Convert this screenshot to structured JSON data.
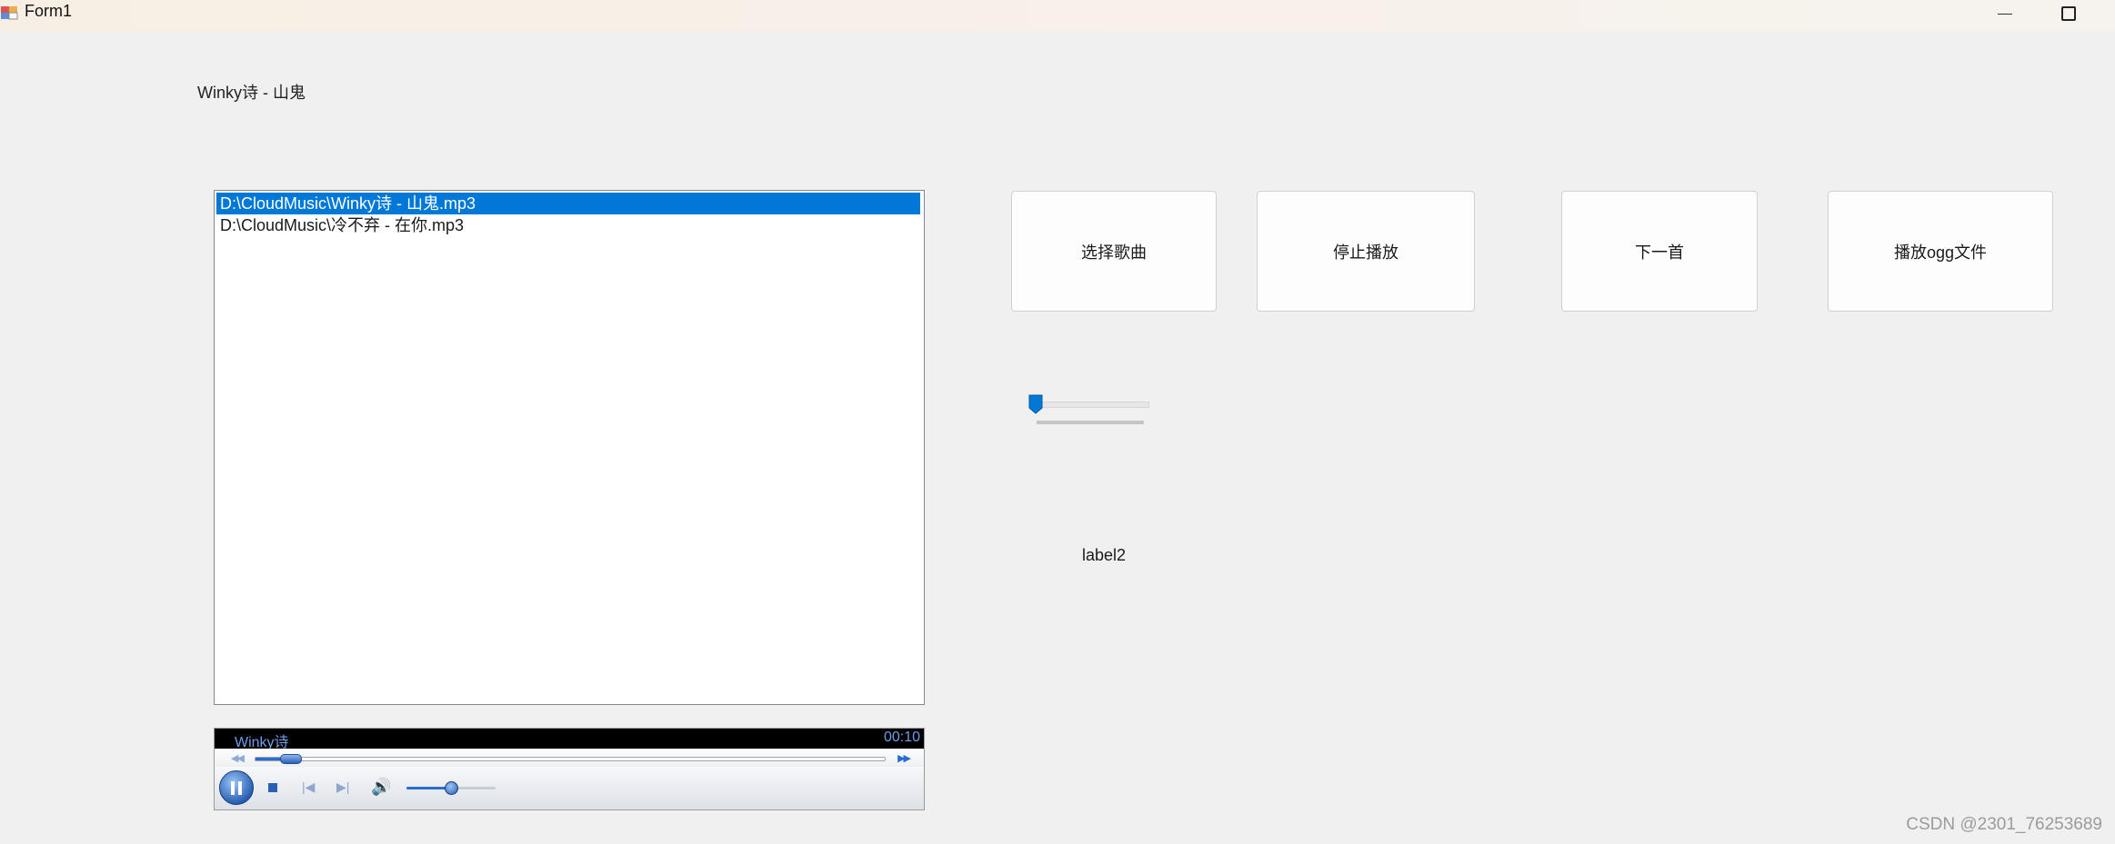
{
  "window": {
    "title": "Form1",
    "minimize_icon": "minimize-icon",
    "maximize_icon": "maximize-icon"
  },
  "current_song_label": "Winky诗 - 山鬼",
  "playlist": {
    "items": [
      {
        "label": "D:\\CloudMusic\\Winky诗 - 山鬼.mp3",
        "selected": true
      },
      {
        "label": "D:\\CloudMusic\\冷不弃 - 在你.mp3",
        "selected": false
      }
    ]
  },
  "player": {
    "track": "Winky诗",
    "time": "00:10",
    "seek_progress": 0.05,
    "volume": 0.5,
    "icons": [
      "pause-icon",
      "stop-icon",
      "previous-icon",
      "next-icon",
      "volume-icon",
      "rewind-icon",
      "fast-forward-icon"
    ]
  },
  "buttons": {
    "select_song": "选择歌曲",
    "stop_play": "停止播放",
    "next_track": "下一首",
    "play_ogg": "播放ogg文件"
  },
  "trackbar": {
    "value": 0
  },
  "label2": "label2",
  "watermark": "CSDN @2301_76253689",
  "colors": {
    "selection": "#0078d7",
    "accent": "#2a5fb5",
    "background": "#f0f0f0"
  }
}
